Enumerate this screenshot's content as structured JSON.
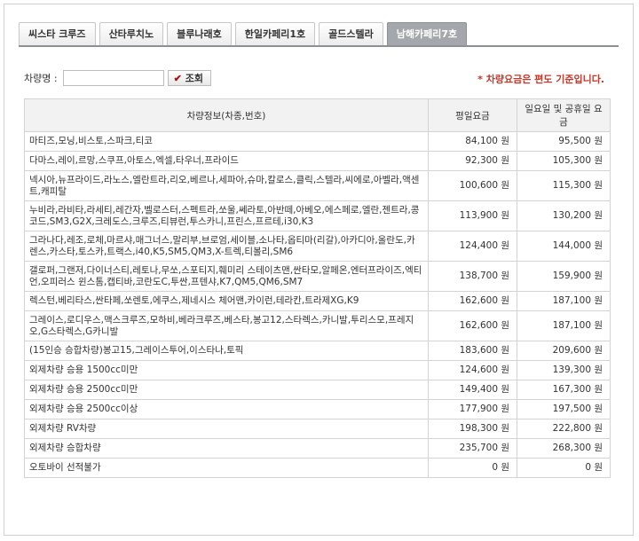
{
  "tabs": [
    {
      "label": "씨스타 크루즈",
      "active": false
    },
    {
      "label": "산타루치노",
      "active": false
    },
    {
      "label": "블루나래호",
      "active": false
    },
    {
      "label": "한일카페리1호",
      "active": false
    },
    {
      "label": "골드스텔라",
      "active": false
    },
    {
      "label": "남해카페리7호",
      "active": true
    }
  ],
  "search": {
    "label": "차량명 :",
    "value": "",
    "button_label": "조회"
  },
  "notice": "* 차량요금은 편도 기준입니다.",
  "table": {
    "headers": [
      "차량정보(차종,번호)",
      "평일요금",
      "일요일 및 공휴일 요금"
    ],
    "rows": [
      {
        "vehicle": "마티즈,모닝,비스토,스파크,티코",
        "weekday": "84,100 원",
        "holiday": "95,500 원"
      },
      {
        "vehicle": "다마스,레이,르망,스쿠프,아토스,엑셀,타우너,프라이드",
        "weekday": "92,300 원",
        "holiday": "105,300 원"
      },
      {
        "vehicle": "넥시아,뉴프라이드,라노스,엘란트라,리오,베르나,세파아,슈마,칼로스,클릭,스텔라,씨에로,아벨라,액센트,캐피탈",
        "weekday": "100,600 원",
        "holiday": "115,300 원"
      },
      {
        "vehicle": "누비라,라비타,라세티,레간자,벨로스터,스펙트라,쏘울,쎄라토,아반떼,아베오,에스페로,엘란,젠트라,콩코드,SM3,G2X,크레도스,크루즈,티뷰런,투스카니,프린스,프르테,i30,K3",
        "weekday": "113,900 원",
        "holiday": "130,200 원"
      },
      {
        "vehicle": "그라나다,레조,로체,마르샤,매그너스,말리부,브로엄,세이블,소나타,옵티마(리갈),아카디아,올란도,카렌스,카스타,토스카,트랙스,i40,K5,SM5,QM3,X-트렉,티볼리,SM6",
        "weekday": "124,400 원",
        "holiday": "144,000 원"
      },
      {
        "vehicle": "갤로퍼,그랜저,다이너스티,레토나,무쏘,스포티지,훼미리 스테이츠맨,싼타모,알페온,엔터프라이즈,엑티언,오피러스 윈스톰,캡티바,코란도C,투싼,프텐샤,K7,QM5,QM6,SM7",
        "weekday": "138,700 원",
        "holiday": "159,900 원"
      },
      {
        "vehicle": "렉스턴,베리타스,싼타페,쏘렌토,에쿠스,제네시스 체어맨,카이런,테라칸,트라제XG,K9",
        "weekday": "162,600 원",
        "holiday": "187,100 원"
      },
      {
        "vehicle": "그레이스,로디우스,맥스크루즈,모하비,베라크루즈,베스타,봉고12,스타렉스,카니발,투리스모,프레지오,G스타렉스,G카니발",
        "weekday": "162,600 원",
        "holiday": "187,100 원"
      },
      {
        "vehicle": "(15인승 승합차량)봉고15,그레이스투어,이스타나,토픽",
        "weekday": "183,600 원",
        "holiday": "209,600 원"
      },
      {
        "vehicle": "외제차량 승용 1500cc미만",
        "weekday": "124,600 원",
        "holiday": "139,300 원"
      },
      {
        "vehicle": "외제차량 승용 2500cc미만",
        "weekday": "149,400 원",
        "holiday": "167,300 원"
      },
      {
        "vehicle": "외제차량 승용 2500cc이상",
        "weekday": "177,900 원",
        "holiday": "197,500 원"
      },
      {
        "vehicle": "외제차량 RV차량",
        "weekday": "198,300 원",
        "holiday": "222,800 원"
      },
      {
        "vehicle": "외제차량 승합차량",
        "weekday": "235,700 원",
        "holiday": "268,300 원"
      },
      {
        "vehicle": "오토바이 선적불가",
        "weekday": "0 원",
        "holiday": "0 원"
      }
    ]
  }
}
